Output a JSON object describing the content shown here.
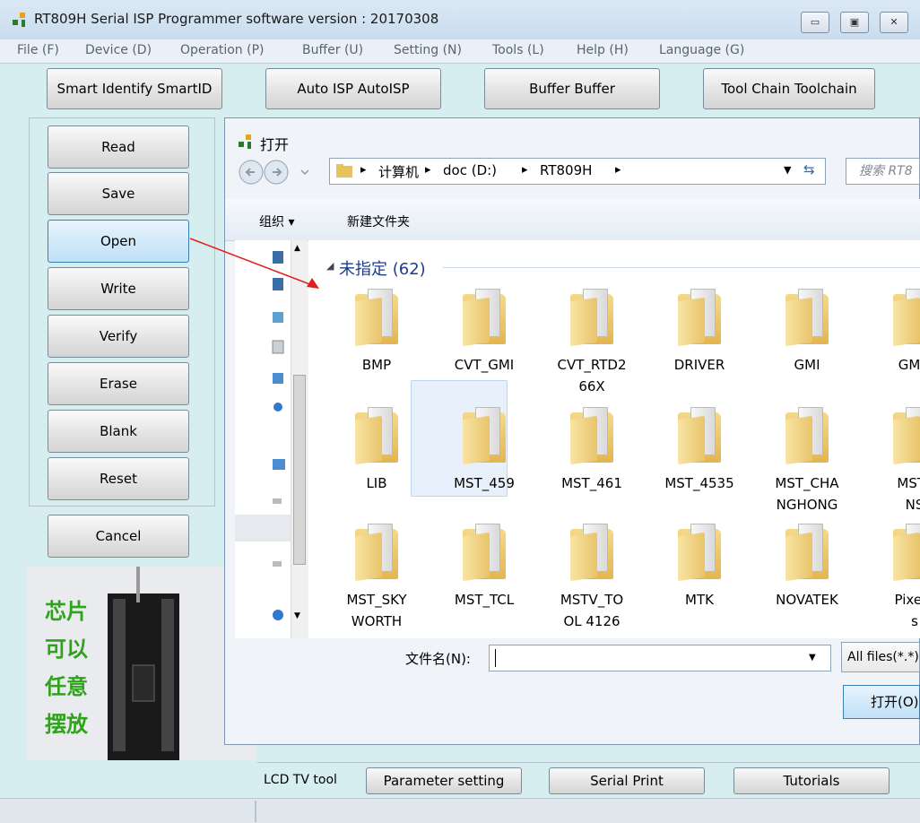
{
  "window": {
    "title": "RT809H Serial ISP Programmer software version : 20170308",
    "controls": [
      "▭",
      "▣",
      "✕"
    ]
  },
  "menu": [
    "File (F)",
    "Device (D)",
    "Operation (P)",
    "Buffer (U)",
    "Setting (N)",
    "Tools (L)",
    "Help (H)",
    "Language (G)"
  ],
  "top_buttons": [
    "Smart Identify SmartID",
    "Auto ISP AutoISP",
    "Buffer Buffer",
    "Tool Chain Toolchain"
  ],
  "side_buttons": [
    "Read",
    "Save",
    "Open",
    "Write",
    "Verify",
    "Erase",
    "Blank",
    "Reset"
  ],
  "cancel_label": "Cancel",
  "photo_text": [
    "芯片",
    "可以",
    "任意",
    "摆放"
  ],
  "dialog": {
    "title": "打开",
    "path": [
      "计算机",
      "doc (D:)",
      "RT809H"
    ],
    "search_placeholder": "搜索 RT8",
    "organize": "组织 ▾",
    "new_folder": "新建文件夹",
    "group_header": "未指定 (62)",
    "folders": [
      [
        "BMP",
        ""
      ],
      [
        "CVT_GMI",
        ""
      ],
      [
        "CVT_RTD2",
        "66X"
      ],
      [
        "DRIVER",
        ""
      ],
      [
        "GMI",
        ""
      ],
      [
        "GMI_",
        ""
      ],
      [
        "LIB",
        ""
      ],
      [
        "MST_459",
        ""
      ],
      [
        "MST_461",
        ""
      ],
      [
        "MST_4535",
        ""
      ],
      [
        "MST_CHA",
        "NGHONG"
      ],
      [
        "MST_",
        "NS"
      ],
      [
        "MST_SKY",
        "WORTH"
      ],
      [
        "MST_TCL",
        ""
      ],
      [
        "MSTV_TO",
        "OL 4126"
      ],
      [
        "MTK",
        ""
      ],
      [
        "NOVATEK",
        ""
      ],
      [
        "PixelV",
        "s"
      ]
    ],
    "filename_label": "文件名(N):",
    "filename_value": "",
    "filetype": "All files(*.*)",
    "open_button": "打开(O)"
  },
  "bottom": {
    "lcd_label": "LCD TV tool",
    "buttons": [
      "Parameter setting",
      "Serial Print",
      "Tutorials"
    ]
  }
}
